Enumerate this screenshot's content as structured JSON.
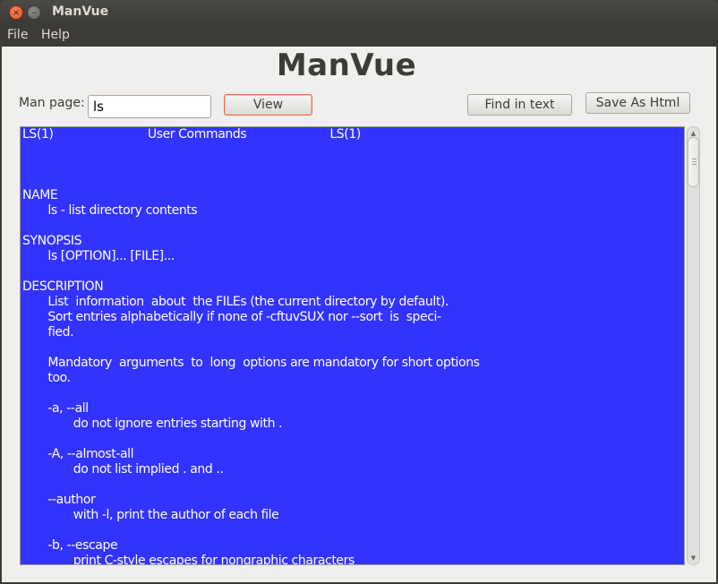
{
  "window": {
    "title": "ManVue",
    "close_icon": "×",
    "minimize_icon": "–"
  },
  "menu": {
    "items": [
      "File",
      "Help"
    ]
  },
  "app": {
    "heading": "ManVue",
    "man_page_label": "Man page:",
    "man_page_value": "ls",
    "view_button": "View",
    "find_button": "Find in text",
    "save_button": "Save As Html"
  },
  "colors": {
    "viewer_background": "#3333ff",
    "viewer_text": "#ffffff",
    "focus_accent": "#e46e47"
  },
  "viewer": {
    "lines": [
      "LS(1)                          User Commands                       LS(1)",
      "",
      "",
      "",
      "NAME",
      "       ls - list directory contents",
      "",
      "SYNOPSIS",
      "       ls [OPTION]... [FILE]...",
      "",
      "DESCRIPTION",
      "       List  information  about  the FILEs (the current directory by default).",
      "       Sort entries alphabetically if none of -cftuvSUX nor --sort  is  speci-",
      "       fied.",
      "",
      "       Mandatory  arguments  to  long  options are mandatory for short options",
      "       too.",
      "",
      "       -a, --all",
      "              do not ignore entries starting with .",
      "",
      "       -A, --almost-all",
      "              do not list implied . and ..",
      "",
      "       --author",
      "              with -l, print the author of each file",
      "",
      "       -b, --escape",
      "              print C-style escapes for nongraphic characters"
    ]
  },
  "scrollbar": {
    "up_icon": "▲",
    "down_icon": "▼",
    "position_fraction": 0.0
  }
}
